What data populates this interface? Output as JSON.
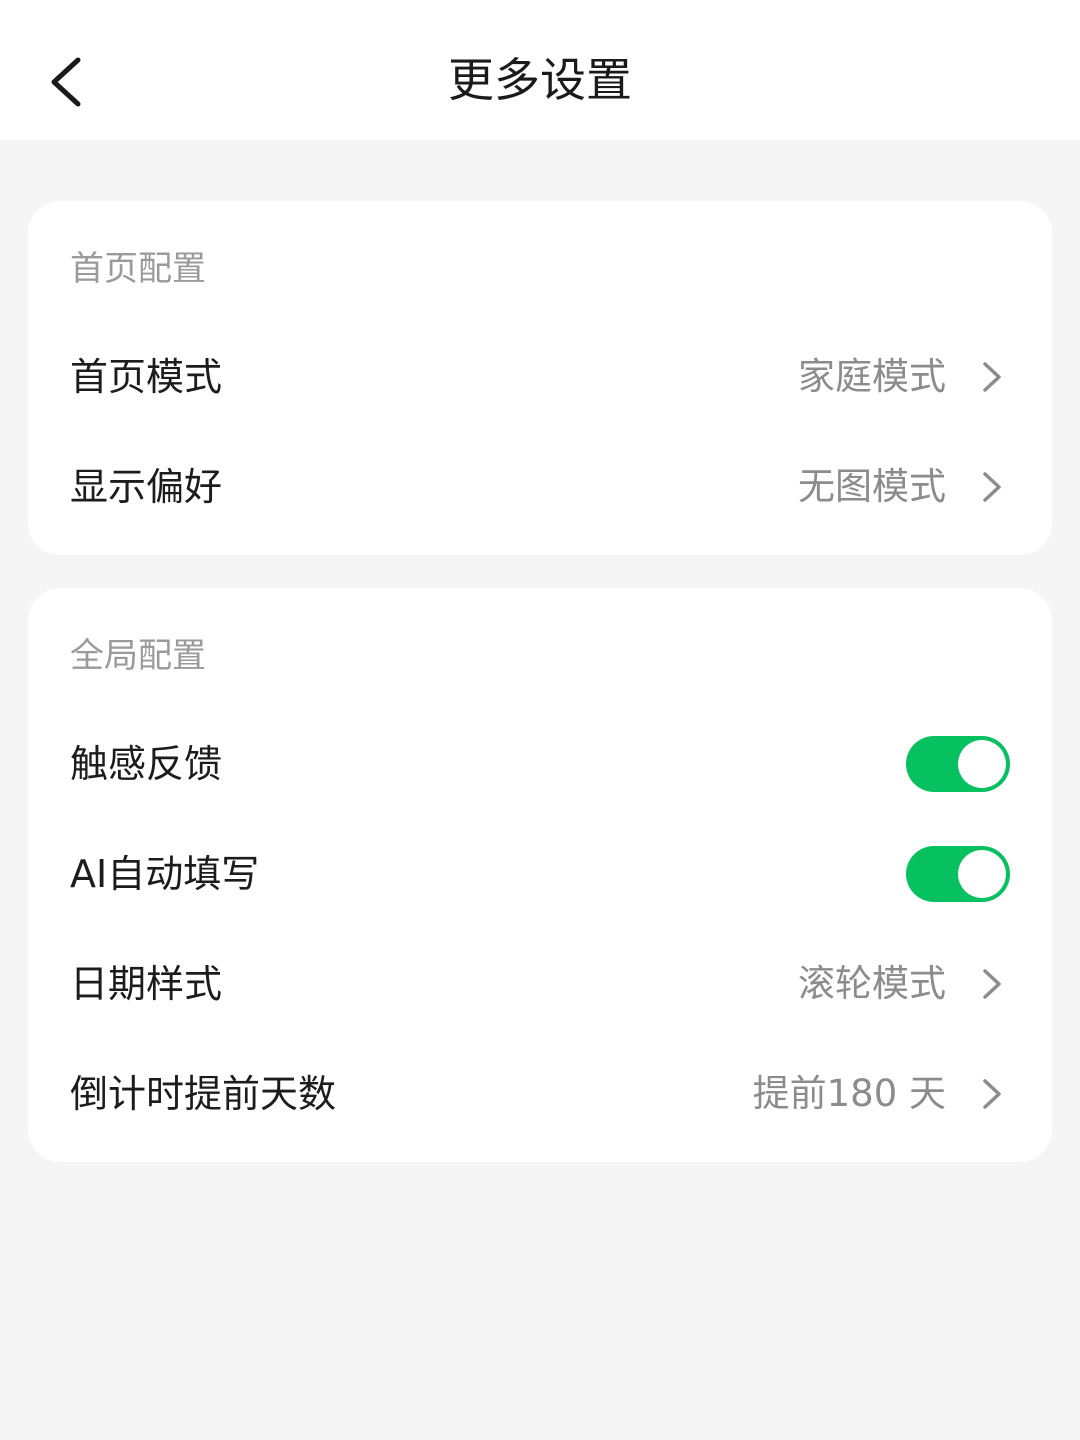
{
  "header": {
    "title": "更多设置",
    "back_icon": "chevron-left-icon"
  },
  "sections": {
    "home": {
      "title": "首页配置",
      "rows": [
        {
          "label": "首页模式",
          "value": "家庭模式",
          "type": "link"
        },
        {
          "label": "显示偏好",
          "value": "无图模式",
          "type": "link"
        }
      ]
    },
    "global": {
      "title": "全局配置",
      "rows": [
        {
          "label": "触感反馈",
          "type": "toggle",
          "on": true
        },
        {
          "label": "AI自动填写",
          "type": "toggle",
          "on": true
        },
        {
          "label": "日期样式",
          "value": "滚轮模式",
          "type": "link"
        },
        {
          "label": "倒计时提前天数",
          "value": "提前180 天",
          "type": "link"
        }
      ]
    }
  },
  "colors": {
    "accent": "#07c160",
    "background": "#f5f5f5",
    "card": "#ffffff",
    "secondary_text": "#8c8c8c"
  }
}
